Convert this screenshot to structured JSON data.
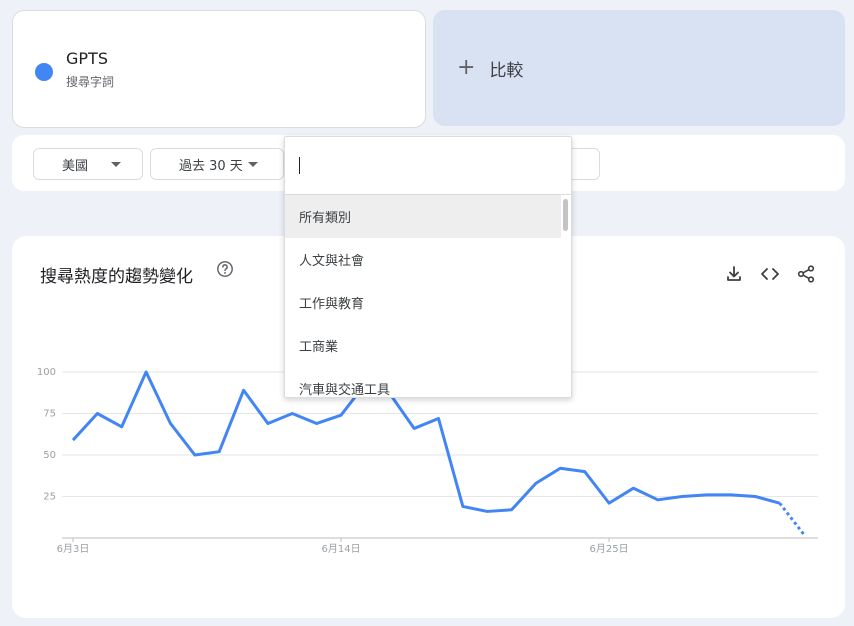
{
  "term": {
    "name": "GPTS",
    "subtitle": "搜尋字詞",
    "color": "#4285f4"
  },
  "compare": {
    "label": "比較",
    "plus": "+",
    "bg": "#d9e2f3"
  },
  "filters": {
    "region": "美國",
    "period": "過去 30 天"
  },
  "dropdown": {
    "items": [
      "所有類別",
      "人文與社會",
      "工作與教育",
      "工商業",
      "汽車與交通工具"
    ],
    "selected_index": 0
  },
  "chart_header": {
    "title": "搜尋熱度的趨勢變化"
  },
  "chart_data": {
    "type": "line",
    "title": "搜尋熱度的趨勢變化",
    "xlabel": "",
    "ylabel": "",
    "ylim": [
      0,
      100
    ],
    "yticks": [
      25,
      50,
      75,
      100
    ],
    "x_tick_labels": [
      {
        "label": "6月3日",
        "day": 0
      },
      {
        "label": "6月14日",
        "day": 11
      },
      {
        "label": "6月25日",
        "day": 22
      }
    ],
    "grid": true,
    "legend": "none",
    "series": [
      {
        "color": "#4285f4",
        "values": [
          59,
          75,
          67,
          100,
          69,
          50,
          52,
          89,
          69,
          75,
          69,
          74,
          93,
          87,
          66,
          72,
          19,
          16,
          17,
          33,
          42,
          40,
          21,
          30,
          23,
          25,
          26,
          26,
          25,
          21,
          2
        ],
        "partial_from_index": 29
      }
    ]
  }
}
